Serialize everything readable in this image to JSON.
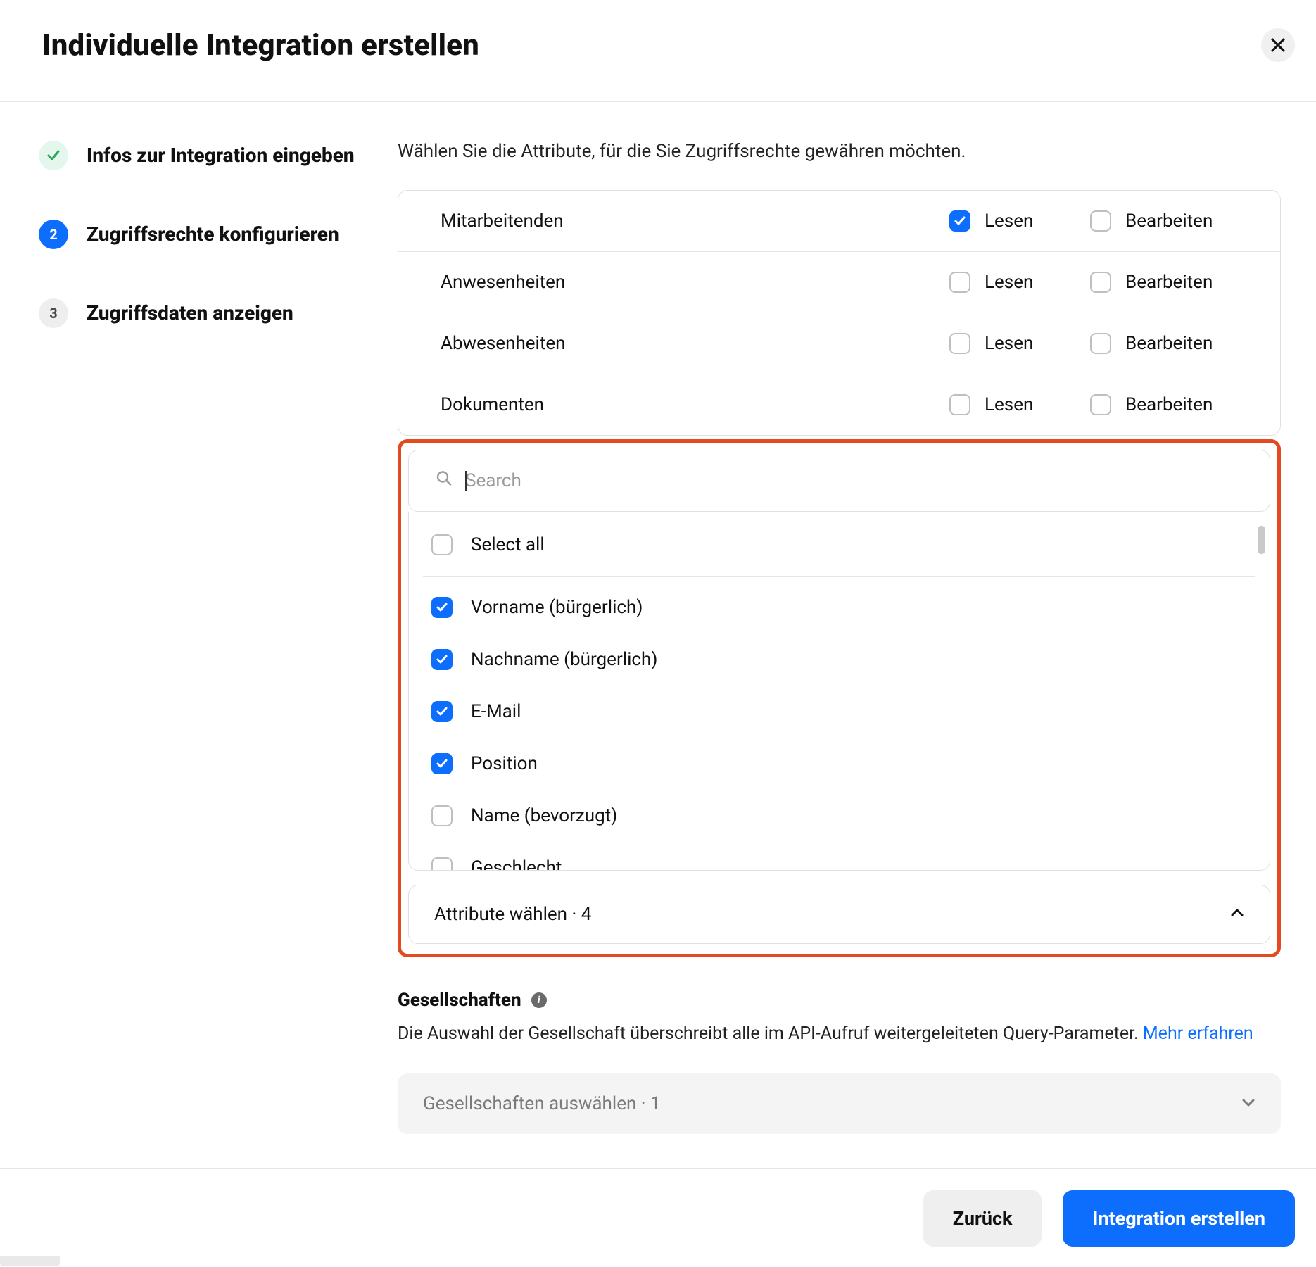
{
  "header": {
    "title": "Individuelle Integration erstellen"
  },
  "stepper": {
    "steps": [
      {
        "label": "Infos zur Integration eingeben",
        "state": "done",
        "num": ""
      },
      {
        "label": "Zugriffsrechte konfigurieren",
        "state": "active",
        "num": "2"
      },
      {
        "label": "Zugriffsdaten anzeigen",
        "state": "future",
        "num": "3"
      }
    ]
  },
  "main": {
    "lead": "Wählen Sie die Attribute, für die Sie Zugriffsrechte gewähren möchten.",
    "perm_labels": {
      "read": "Lesen",
      "edit": "Bearbeiten"
    },
    "permissions": [
      {
        "name": "Mitarbeitenden",
        "read": true,
        "edit": false
      },
      {
        "name": "Anwesenheiten",
        "read": false,
        "edit": false
      },
      {
        "name": "Abwesenheiten",
        "read": false,
        "edit": false
      },
      {
        "name": "Dokumenten",
        "read": false,
        "edit": false
      }
    ],
    "search": {
      "placeholder": "Search",
      "value": ""
    },
    "attributes": {
      "select_all_label": "Select all",
      "items": [
        {
          "label": "Vorname (bürgerlich)",
          "checked": true
        },
        {
          "label": "Nachname (bürgerlich)",
          "checked": true
        },
        {
          "label": "E-Mail",
          "checked": true
        },
        {
          "label": "Position",
          "checked": true
        },
        {
          "label": "Name (bevorzugt)",
          "checked": false
        },
        {
          "label": "Geschlecht",
          "checked": false
        }
      ],
      "summary_prefix": "Attribute wählen",
      "summary_count": "4"
    },
    "companies": {
      "title": "Gesellschaften",
      "desc": "Die Auswahl der Gesellschaft überschreibt alle im API-Aufruf weitergeleiteten Query-Parameter. ",
      "link": "Mehr erfahren",
      "select_prefix": "Gesellschaften auswählen",
      "select_count": "1"
    }
  },
  "footer": {
    "back": "Zurück",
    "create": "Integration erstellen"
  }
}
